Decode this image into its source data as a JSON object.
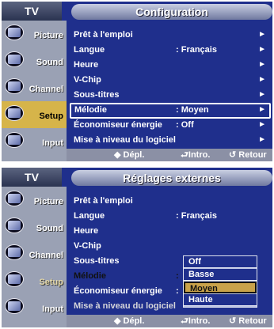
{
  "screen1": {
    "title": "TV",
    "header": "Configuration",
    "sidebar": [
      {
        "label": "Picture",
        "icon": "picture-icon"
      },
      {
        "label": "Sound",
        "icon": "sound-icon"
      },
      {
        "label": "Channel",
        "icon": "channel-icon"
      },
      {
        "label": "Setup",
        "icon": "setup-icon"
      },
      {
        "label": "Input",
        "icon": "input-icon"
      }
    ],
    "active_sidebar": "Setup",
    "items": [
      {
        "label": "Prêt à l'emploi",
        "value": "",
        "arrow": "►"
      },
      {
        "label": "Langue",
        "value": ": Français",
        "arrow": "►"
      },
      {
        "label": "Heure",
        "value": "",
        "arrow": "►"
      },
      {
        "label": "V-Chip",
        "value": "",
        "arrow": "►"
      },
      {
        "label": "Sous-titres",
        "value": "",
        "arrow": "►"
      },
      {
        "label": "Mélodie",
        "value": ":   Moyen",
        "arrow": "►"
      },
      {
        "label": "Économiseur énergie",
        "value": ": Off",
        "arrow": "►"
      },
      {
        "label": "Mise à niveau du logiciel",
        "value": "",
        "arrow": "►"
      }
    ],
    "selected_item": "Mélodie",
    "footer": {
      "move": "◆ Dépl.",
      "enter": "⮐Intro.",
      "return": "↺ Retour"
    }
  },
  "screen2": {
    "title": "TV",
    "header": "Réglages externes",
    "sidebar": [
      {
        "label": "Picture",
        "icon": "picture-icon"
      },
      {
        "label": "Sound",
        "icon": "sound-icon"
      },
      {
        "label": "Channel",
        "icon": "channel-icon"
      },
      {
        "label": "Setup",
        "icon": "setup-icon"
      },
      {
        "label": "Input",
        "icon": "input-icon"
      }
    ],
    "items": [
      {
        "label": "Prêt à l'emploi",
        "value": ""
      },
      {
        "label": "Langue",
        "value": ": Français"
      },
      {
        "label": "Heure",
        "value": ""
      },
      {
        "label": "V-Chip",
        "value": ""
      },
      {
        "label": "Sous-titres",
        "value": ""
      },
      {
        "label": "Mélodie",
        "value": ":"
      },
      {
        "label": "Économiseur énergie",
        "value": ":"
      },
      {
        "label": "Mise à niveau du logiciel",
        "value": ""
      }
    ],
    "dropdown": {
      "options": [
        "Off",
        "Basse",
        "Moyen",
        "Haute"
      ],
      "selected": "Moyen"
    },
    "footer": {
      "move": "◆ Dépl.",
      "enter": "⮐Intro.",
      "return": "↺ Retour"
    }
  }
}
